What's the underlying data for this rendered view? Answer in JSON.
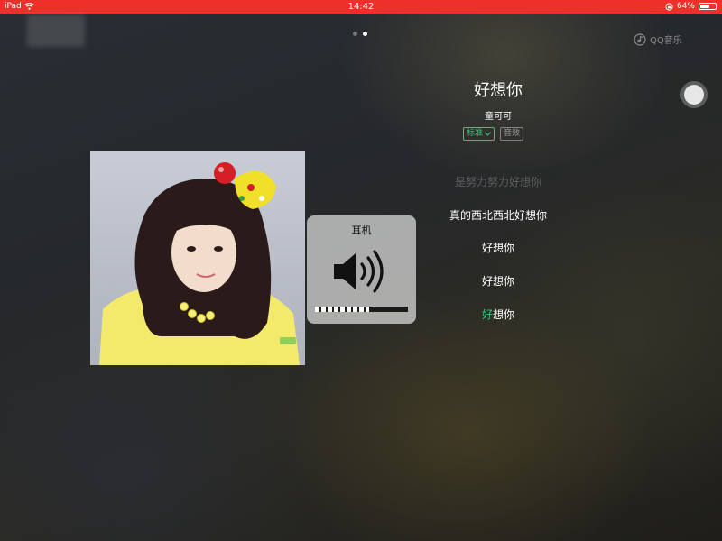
{
  "status_bar": {
    "device": "iPad",
    "time": "14:42",
    "battery_text": "64%",
    "battery_level": 0.64
  },
  "page_indicator": {
    "count": 2,
    "active_index": 1
  },
  "brand": {
    "name": "QQ音乐",
    "icon": "qq-music-logo-icon"
  },
  "song": {
    "title": "好想你",
    "artist": "童可可",
    "quality_label": "标准",
    "effect_label": "音效"
  },
  "lyrics": {
    "faded": "是努力努力好想你",
    "lines": [
      "真的西北西北好想你",
      "好想你",
      "好想你"
    ],
    "current_highlight": "好",
    "current_rest": "想你"
  },
  "volume_hud": {
    "title": "耳机",
    "icon": "speaker-volume-icon",
    "level": 0.58
  },
  "colors": {
    "status_bar": "#ef2f2a",
    "accent_green": "#3fc37c"
  }
}
